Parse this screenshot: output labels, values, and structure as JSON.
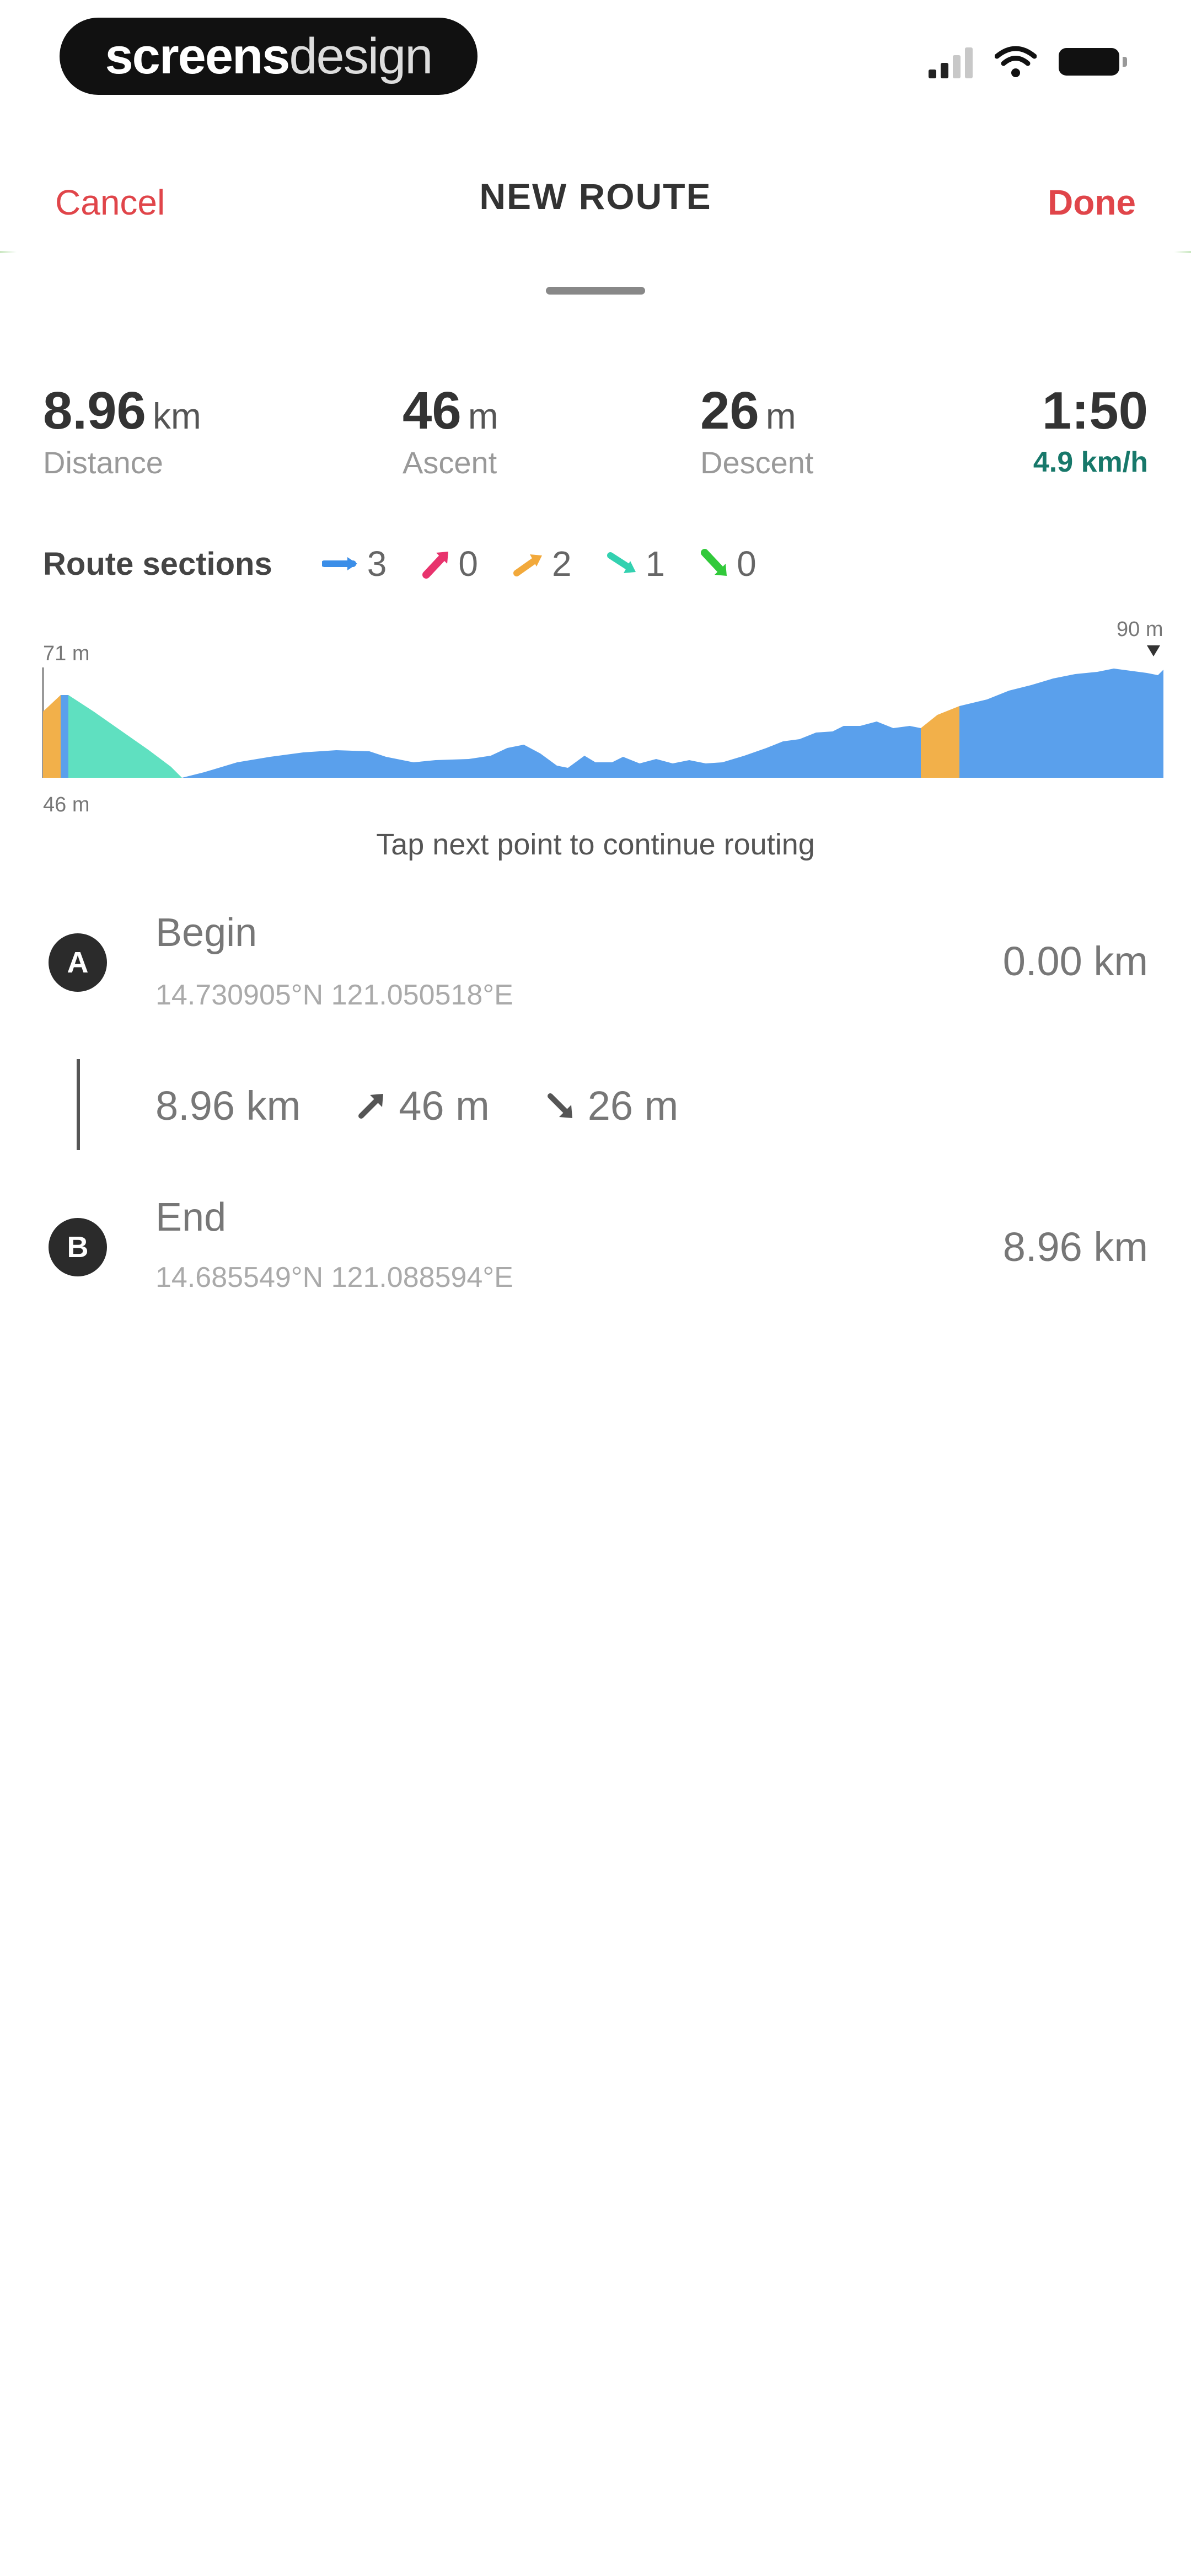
{
  "status_bar": {
    "brand_bold": "screens",
    "brand_light": "design"
  },
  "nav": {
    "cancel_label": "Cancel",
    "title": "NEW ROUTE",
    "done_label": "Done"
  },
  "stats": {
    "distance": {
      "value": "8.96",
      "unit": "km",
      "label": "Distance"
    },
    "ascent": {
      "value": "46",
      "unit": "m",
      "label": "Ascent"
    },
    "descent": {
      "value": "26",
      "unit": "m",
      "label": "Descent"
    },
    "duration": {
      "value": "1:50",
      "speed": "4.9 km/h"
    }
  },
  "route_sections": {
    "title": "Route sections",
    "items": [
      {
        "icon": "flat-arrow-icon",
        "count": "3",
        "color": "#3b8ee8"
      },
      {
        "icon": "steep-up-arrow-icon",
        "count": "0",
        "color": "#e8336d"
      },
      {
        "icon": "up-arrow-icon",
        "count": "2",
        "color": "#f2a93b"
      },
      {
        "icon": "down-arrow-icon",
        "count": "1",
        "color": "#33d1b0"
      },
      {
        "icon": "steep-down-arrow-icon",
        "count": "0",
        "color": "#31c93a"
      }
    ]
  },
  "chart_data": {
    "type": "area",
    "max_label": "71 m",
    "min_label": "46 m",
    "end_label": "90 m",
    "colors": {
      "flat": "#5aa0ec",
      "up": "#f2b04a",
      "down": "#5fe0c0"
    },
    "y_range": [
      46,
      90
    ]
  },
  "hint": "Tap next point to continue routing",
  "waypoints": [
    {
      "marker": "A",
      "name": "Begin",
      "coords": "14.730905°N 121.050518°E",
      "distance": "0.00 km"
    },
    {
      "marker": "B",
      "name": "End",
      "coords": "14.685549°N 121.088594°E",
      "distance": "8.96 km"
    }
  ],
  "leg": {
    "distance": "8.96 km",
    "ascent": "46 m",
    "descent": "26 m"
  }
}
